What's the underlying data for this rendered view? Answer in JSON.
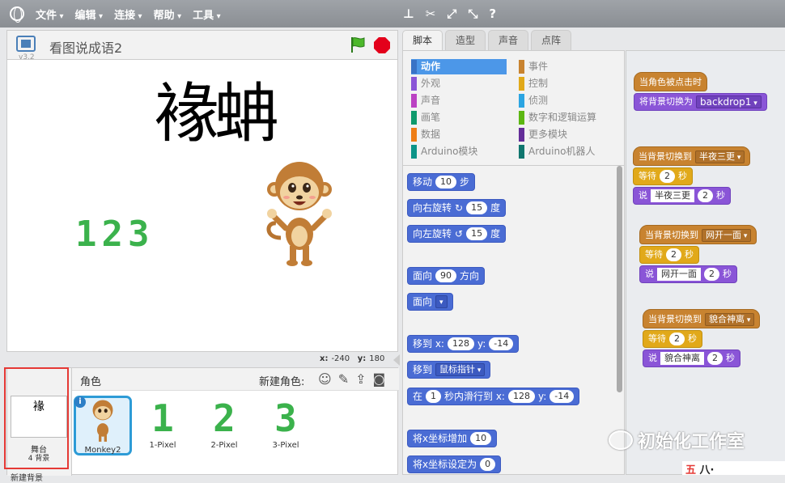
{
  "menu": {
    "items": [
      "文件",
      "编辑",
      "连接",
      "帮助",
      "工具"
    ]
  },
  "stage": {
    "version": "v3.2",
    "project_title": "看图说成语2",
    "display_chars": "褖蚺",
    "display_digits": "123",
    "coord_x_label": "x:",
    "coord_x": "-240",
    "coord_y_label": "y:",
    "coord_y": "180"
  },
  "sprites": {
    "header": "角色",
    "new_sprite_label": "新建角色:",
    "stage_thumb_text": "褖",
    "stage_label": "舞台",
    "stage_backdrop_count": "4 背景",
    "new_backdrop_label": "新建背景",
    "items": [
      {
        "name": "Monkey2",
        "glyph": ""
      },
      {
        "name": "1-Pixel",
        "glyph": "1"
      },
      {
        "name": "2-Pixel",
        "glyph": "2"
      },
      {
        "name": "3-Pixel",
        "glyph": "3"
      }
    ]
  },
  "tabs": [
    "脚本",
    "造型",
    "声音",
    "点阵"
  ],
  "categories": [
    {
      "label": "动作",
      "color": "#4a6cd4"
    },
    {
      "label": "事件",
      "color": "#c88330"
    },
    {
      "label": "外观",
      "color": "#8a55d7"
    },
    {
      "label": "控制",
      "color": "#e1a91a"
    },
    {
      "label": "声音",
      "color": "#bb42c3"
    },
    {
      "label": "侦测",
      "color": "#2ca5e2"
    },
    {
      "label": "画笔",
      "color": "#0e9a6c"
    },
    {
      "label": "数字和逻辑运算",
      "color": "#5cb712"
    },
    {
      "label": "数据",
      "color": "#ee7d16"
    },
    {
      "label": "更多模块",
      "color": "#632d99"
    },
    {
      "label": "Arduino模块",
      "color": "#0d9488"
    },
    {
      "label": "Arduino机器人",
      "color": "#0f766e"
    }
  ],
  "palette": {
    "move": {
      "a": "移动",
      "v": "10",
      "b": "步"
    },
    "turn_right": {
      "a": "向右旋转",
      "v": "15",
      "b": "度"
    },
    "turn_left": {
      "a": "向左旋转",
      "v": "15",
      "b": "度"
    },
    "point_dir": {
      "a": "面向",
      "v": "90",
      "b": "方向"
    },
    "point_towards": {
      "a": "面向"
    },
    "goto_xy": {
      "a": "移到 x:",
      "x": "128",
      "b": "y:",
      "y": "-14"
    },
    "goto_target": {
      "a": "移到",
      "v": "鼠标指针"
    },
    "glide": {
      "a": "在",
      "t": "1",
      "b": "秒内滑行到 x:",
      "x": "128",
      "c": "y:",
      "y": "-14"
    },
    "change_x": {
      "a": "将x坐标增加",
      "v": "10"
    },
    "set_x": {
      "a": "将x坐标设定为",
      "v": "0"
    }
  },
  "scripts": {
    "s1": {
      "hat": "当角色被点击时",
      "action": "将背景切换为",
      "value": "backdrop1"
    },
    "s2": {
      "hat": "当背景切换到",
      "bd": "半夜三更",
      "wait": "等待",
      "wv": "2",
      "wu": "秒",
      "say": "说",
      "text": "半夜三更",
      "sv": "2",
      "su": "秒"
    },
    "s3": {
      "hat": "当背景切换到",
      "bd": "网开一面",
      "wait": "等待",
      "wv": "2",
      "wu": "秒",
      "say": "说",
      "text": "网开一面",
      "sv": "2",
      "su": "秒"
    },
    "s4": {
      "hat": "当背景切换到",
      "bd": "貌合神离",
      "wait": "等待",
      "wv": "2",
      "wu": "秒",
      "say": "说",
      "text": "貌合神离",
      "sv": "2",
      "su": "秒"
    }
  },
  "watermark": {
    "text": "初始化工作室",
    "logo_text": "五",
    "logo_rest": "八·"
  }
}
